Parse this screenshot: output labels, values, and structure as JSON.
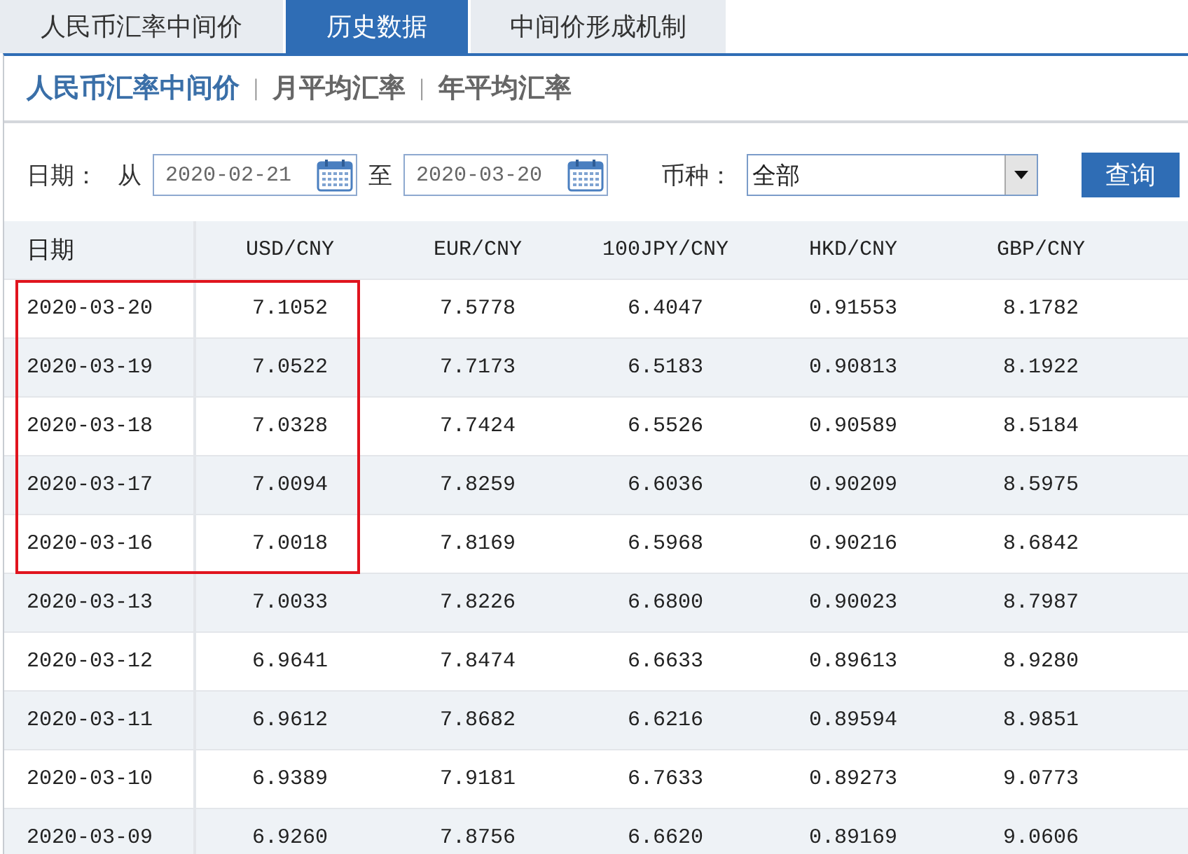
{
  "tabs": [
    {
      "label": "人民币汇率中间价",
      "selected": false
    },
    {
      "label": "历史数据",
      "selected": true
    },
    {
      "label": "中间价形成机制",
      "selected": false
    }
  ],
  "subnav": [
    {
      "label": "人民币汇率中间价",
      "selected": true
    },
    {
      "label": "月平均汇率",
      "selected": false
    },
    {
      "label": "年平均汇率",
      "selected": false
    }
  ],
  "subnav_separator": "|",
  "filter": {
    "date_label": "日期：",
    "from_label": "从",
    "from_value": "2020-02-21",
    "to_label": "至",
    "to_value": "2020-03-20",
    "currency_label": "币种：",
    "currency_value": "全部",
    "query_button": "查询"
  },
  "table": {
    "columns": [
      "日期",
      "USD/CNY",
      "EUR/CNY",
      "100JPY/CNY",
      "HKD/CNY",
      "GBP/CNY"
    ],
    "rows": [
      {
        "cells": [
          "2020-03-20",
          "7.1052",
          "7.5778",
          "6.4047",
          "0.91553",
          "8.1782"
        ],
        "highlighted": true
      },
      {
        "cells": [
          "2020-03-19",
          "7.0522",
          "7.7173",
          "6.5183",
          "0.90813",
          "8.1922"
        ],
        "highlighted": true
      },
      {
        "cells": [
          "2020-03-18",
          "7.0328",
          "7.7424",
          "6.5526",
          "0.90589",
          "8.5184"
        ],
        "highlighted": true
      },
      {
        "cells": [
          "2020-03-17",
          "7.0094",
          "7.8259",
          "6.6036",
          "0.90209",
          "8.5975"
        ],
        "highlighted": true
      },
      {
        "cells": [
          "2020-03-16",
          "7.0018",
          "7.8169",
          "6.5968",
          "0.90216",
          "8.6842"
        ],
        "highlighted": true
      },
      {
        "cells": [
          "2020-03-13",
          "7.0033",
          "7.8226",
          "6.6800",
          "0.90023",
          "8.7987"
        ],
        "highlighted": false
      },
      {
        "cells": [
          "2020-03-12",
          "6.9641",
          "7.8474",
          "6.6633",
          "0.89613",
          "8.9280"
        ],
        "highlighted": false
      },
      {
        "cells": [
          "2020-03-11",
          "6.9612",
          "7.8682",
          "6.6216",
          "0.89594",
          "8.9851"
        ],
        "highlighted": false
      },
      {
        "cells": [
          "2020-03-10",
          "6.9389",
          "7.9181",
          "6.7633",
          "0.89273",
          "9.0773"
        ],
        "highlighted": false
      },
      {
        "cells": [
          "2020-03-09",
          "6.9260",
          "7.8756",
          "6.6620",
          "0.89169",
          "9.0606"
        ],
        "highlighted": false
      }
    ]
  }
}
